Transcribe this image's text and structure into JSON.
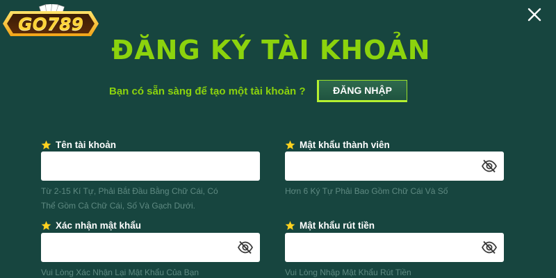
{
  "logo": {
    "text": "GO789"
  },
  "title": "ĐĂNG KÝ TÀI KHOẢN",
  "prompt": {
    "text": "Bạn có sẵn sàng để tạo một tài khoản ?",
    "login_label": "ĐĂNG NHẬP"
  },
  "fields": {
    "username": {
      "label": "Tên tài khoản",
      "value": "",
      "hint_line1": "Từ 2-15 Kí Tự, Phải Bắt Đầu Bằng Chữ Cái, Có",
      "hint_line2": "Thể Gồm Cả Chữ Cái, Số Và Gạch Dưới."
    },
    "password": {
      "label": "Mật khẩu thành viên",
      "value": "",
      "hint": "Hơn 6 Ký Tự Phải Bao Gồm Chữ Cái Và Số"
    },
    "confirm_password": {
      "label": "Xác nhận mật khẩu",
      "value": "",
      "hint": "Vui Lòng Xác Nhận Lại Mật Khẩu Của Bạn"
    },
    "withdraw_password": {
      "label": "Mật khẩu rút tiền",
      "value": "",
      "hint": "Vui Lòng Nhập Mật Khẩu Rút Tiền"
    }
  },
  "icons": {
    "close": "close-icon",
    "star": "star-icon",
    "eye": "eye-slash-icon"
  },
  "colors": {
    "background": "#17453f",
    "accent_green": "#8cd30d",
    "star": "#ffd21f",
    "hint": "#5f8a82"
  }
}
